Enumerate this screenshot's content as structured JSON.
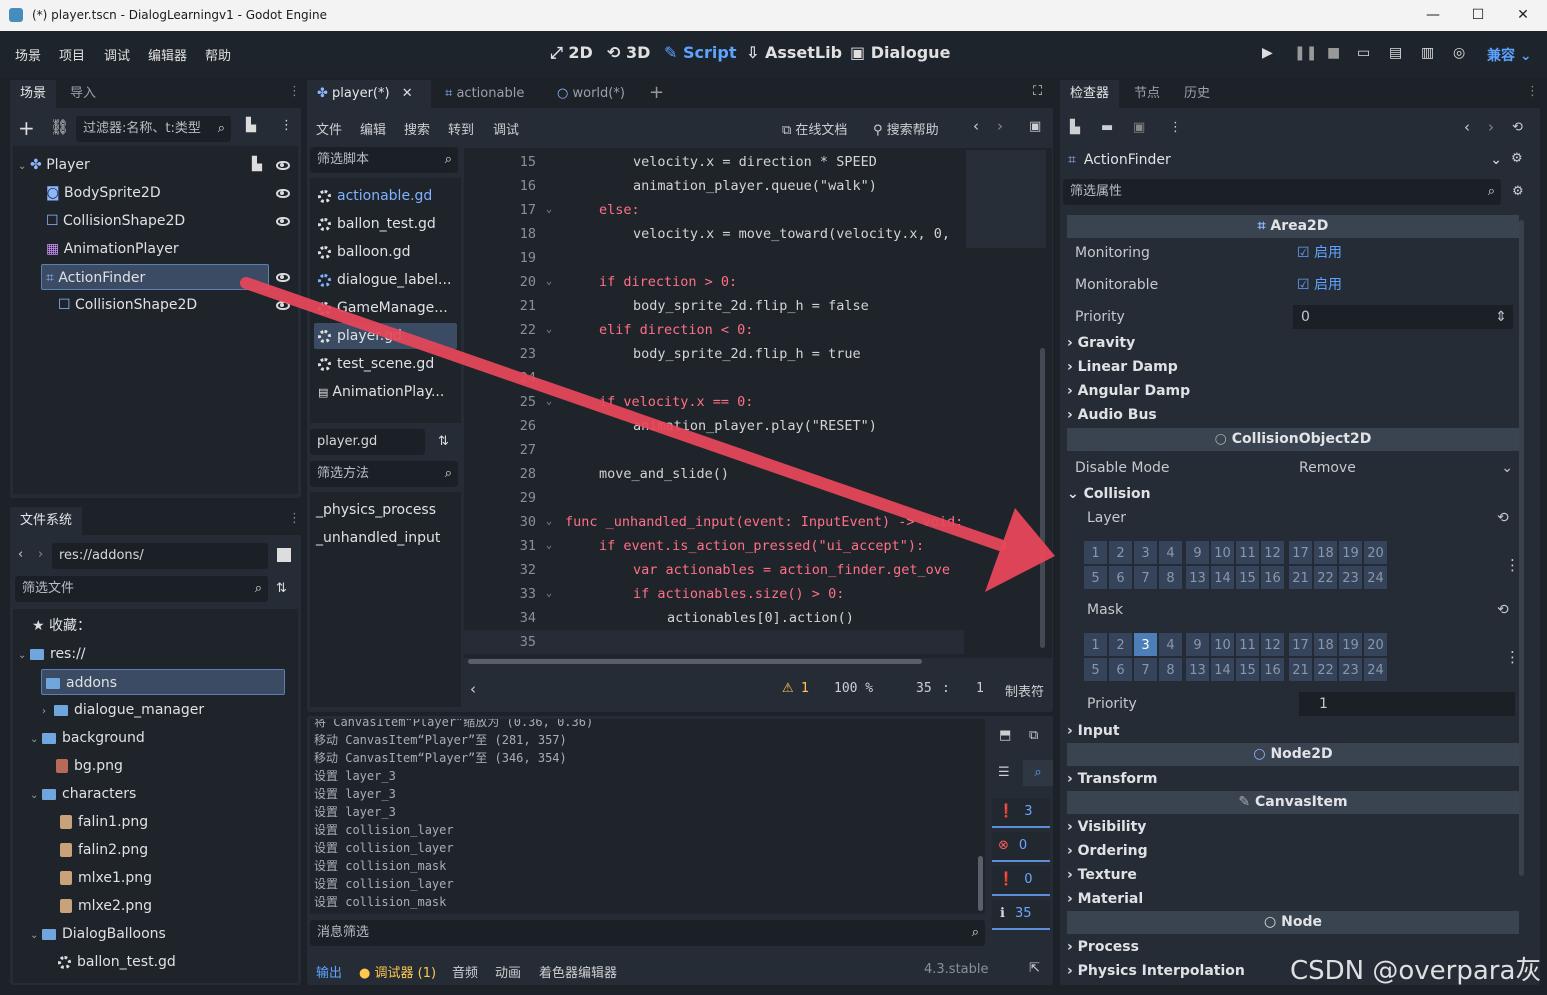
{
  "window": {
    "title": "(*) player.tscn - DialogLearningv1 - Godot Engine",
    "min": "—",
    "max": "☐",
    "close": "✕"
  },
  "menu": [
    "场景",
    "项目",
    "调试",
    "编辑器",
    "帮助"
  ],
  "workspaces": [
    "2D",
    "3D",
    "Script",
    "AssetLib",
    "Dialogue"
  ],
  "renderer": "兼容",
  "scene_dock": {
    "tabs": [
      "场景",
      "导入"
    ],
    "filter_placeholder": "过滤器:名称、t:类型",
    "nodes": [
      "Player",
      "BodySprite2D",
      "CollisionShape2D",
      "AnimationPlayer",
      "ActionFinder",
      "CollisionShape2D"
    ]
  },
  "fs_dock": {
    "tab": "文件系统",
    "path": "res://addons/",
    "filter_placeholder": "筛选文件",
    "items": [
      "收藏：",
      "res://",
      "addons",
      "dialogue_manager",
      "background",
      "bg.png",
      "characters",
      "falin1.png",
      "falin2.png",
      "mlxe1.png",
      "mlxe2.png",
      "DialogBalloons",
      "ballon_test.gd"
    ]
  },
  "script_tabs": [
    "player(*)",
    "actionable",
    "world(*)"
  ],
  "script_menu": [
    "文件",
    "编辑",
    "搜索",
    "转到",
    "调试"
  ],
  "script_help": [
    "在线文档",
    "搜索帮助"
  ],
  "script_list": {
    "filter_placeholder": "筛选脚本",
    "items": [
      "actionable.gd",
      "ballon_test.gd",
      "balloon.gd",
      "dialogue_label...",
      "GameManage...",
      "player.gd",
      "test_scene.gd",
      "AnimationPlay..."
    ],
    "current": "player.gd",
    "methods_filter": "筛选方法",
    "methods": [
      "_physics_process",
      "_unhandled_input"
    ]
  },
  "code_lines": [
    {
      "n": "15",
      "code": "velocity.x = direction * SPEED"
    },
    {
      "n": "16",
      "code": "animation_player.queue(\"walk\")"
    },
    {
      "n": "17",
      "code": "else:"
    },
    {
      "n": "18",
      "code": "velocity.x = move_toward(velocity.x, 0,"
    },
    {
      "n": "19",
      "code": ""
    },
    {
      "n": "20",
      "code": "if direction > 0:"
    },
    {
      "n": "21",
      "code": "body_sprite_2d.flip_h = false"
    },
    {
      "n": "22",
      "code": "elif direction < 0:"
    },
    {
      "n": "23",
      "code": "body_sprite_2d.flip_h = true"
    },
    {
      "n": "24",
      "code": ""
    },
    {
      "n": "25",
      "code": "if velocity.x == 0:"
    },
    {
      "n": "26",
      "code": "animation_player.play(\"RESET\")"
    },
    {
      "n": "27",
      "code": ""
    },
    {
      "n": "28",
      "code": "move_and_slide()"
    },
    {
      "n": "29",
      "code": ""
    },
    {
      "n": "30",
      "code": "func _unhandled_input(event: InputEvent) -> void:"
    },
    {
      "n": "31",
      "code": "if event.is_action_pressed(\"ui_accept\"):"
    },
    {
      "n": "32",
      "code": "var actionables = action_finder.get_ove"
    },
    {
      "n": "33",
      "code": "if actionables.size() > 0:"
    },
    {
      "n": "34",
      "code": "actionables[0].action()"
    },
    {
      "n": "35",
      "code": ""
    }
  ],
  "status": {
    "warnings": "1",
    "zoom": "100 %",
    "line": "35",
    "sep": ":",
    "col": "1",
    "indent": "制表符"
  },
  "output": {
    "lines": [
      "将 CanvasItem“Player”缩放为 (0.36, 0.36)",
      "移动 CanvasItem“Player”至 (281, 357)",
      "移动 CanvasItem“Player”至 (346, 354)",
      "设置 layer_3",
      "设置 layer_3",
      "设置 layer_3",
      "设置 collision_layer",
      "设置 collision_layer",
      "设置 collision_mask",
      "设置 collision_layer",
      "设置 collision_mask"
    ],
    "filter_placeholder": "消息筛选",
    "counts": [
      "3",
      "0",
      "0",
      "35"
    ]
  },
  "bottom_tabs": [
    "输出",
    "调试器 (1)",
    "音频",
    "动画",
    "着色器编辑器"
  ],
  "version": "4.3.stable",
  "inspector": {
    "tabs": [
      "检查器",
      "节点",
      "历史"
    ],
    "object": "ActionFinder",
    "filter_placeholder": "筛选属性",
    "area2d": "Area2D",
    "monitoring": "Monitoring",
    "monitorable": "Monitorable",
    "on": "启用",
    "priority": "Priority",
    "priority_val": "0",
    "groups1": [
      "Gravity",
      "Linear Damp",
      "Angular Damp",
      "Audio Bus"
    ],
    "collision_object": "CollisionObject2D",
    "disable_mode": "Disable Mode",
    "disable_val": "Remove",
    "collision": "Collision",
    "layer": "Layer",
    "mask": "Mask",
    "grid_top": [
      "1",
      "2",
      "3",
      "4",
      "9",
      "10",
      "11",
      "12",
      "17",
      "18",
      "19",
      "20"
    ],
    "grid_bot": [
      "5",
      "6",
      "7",
      "8",
      "13",
      "14",
      "15",
      "16",
      "21",
      "22",
      "23",
      "24"
    ],
    "priority2_val": "1",
    "input": "Input",
    "node2d": "Node2D",
    "transform": "Transform",
    "canvasitem": "CanvasItem",
    "groups2": [
      "Visibility",
      "Ordering",
      "Texture",
      "Material"
    ],
    "node": "Node",
    "groups3": [
      "Process",
      "Physics Interpolation"
    ]
  },
  "watermark": "CSDN @overpara灰",
  "colors": {
    "accent": "#5ea3ff",
    "arrow": "#f0505f",
    "bg": "#1d2229",
    "panel": "#262c35"
  }
}
